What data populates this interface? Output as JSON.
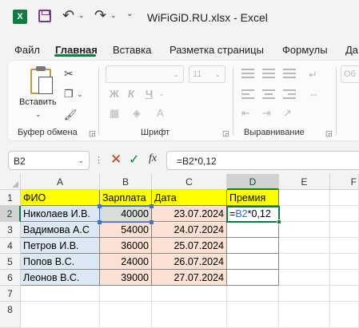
{
  "app": {
    "title": "WiFiGiD.RU.xlsx  -  Excel",
    "logo_letter": "X",
    "accent_color": "#107c41"
  },
  "tabs": [
    {
      "label": "Файл",
      "active": false
    },
    {
      "label": "Главная",
      "active": true
    },
    {
      "label": "Вставка",
      "active": false
    },
    {
      "label": "Разметка страницы",
      "active": false
    },
    {
      "label": "Формулы",
      "active": false
    },
    {
      "label": "Да",
      "active": false
    }
  ],
  "ribbon": {
    "clipboard": {
      "label": "Буфер обмена",
      "paste_label": "Вставить"
    },
    "font": {
      "label": "Шрифт",
      "font_size": "11",
      "bold": "Ж",
      "italic": "К",
      "underline": "Ч"
    },
    "alignment": {
      "label": "Выравнивание"
    },
    "number": {
      "partial_label": "Об"
    }
  },
  "formula_bar": {
    "name_box": "B2",
    "fx_symbol": "fx",
    "formula": "=B2*0,12"
  },
  "columns": [
    "A",
    "B",
    "C",
    "D",
    "E",
    "F"
  ],
  "rows": [
    "1",
    "2",
    "3",
    "4",
    "5",
    "6",
    "7",
    "8"
  ],
  "table": {
    "headers": [
      "ФИО",
      "Зарплата",
      "Дата",
      "Премия"
    ],
    "rows": [
      {
        "name": "Николаев И.В.",
        "salary": "40000",
        "date": "23.07.2024"
      },
      {
        "name": "Вадимова А.С",
        "salary": "54000",
        "date": "24.07.2024"
      },
      {
        "name": "Петров И.В.",
        "salary": "36000",
        "date": "25.07.2024"
      },
      {
        "name": "Попов В.С.",
        "salary": "24000",
        "date": "26.07.2024"
      },
      {
        "name": "Леонов В.С.",
        "salary": "39000",
        "date": "27.07.2024"
      }
    ]
  },
  "active_cell": {
    "address": "D2",
    "prefix": "=",
    "ref": "B2",
    "suffix": "*0,12"
  }
}
